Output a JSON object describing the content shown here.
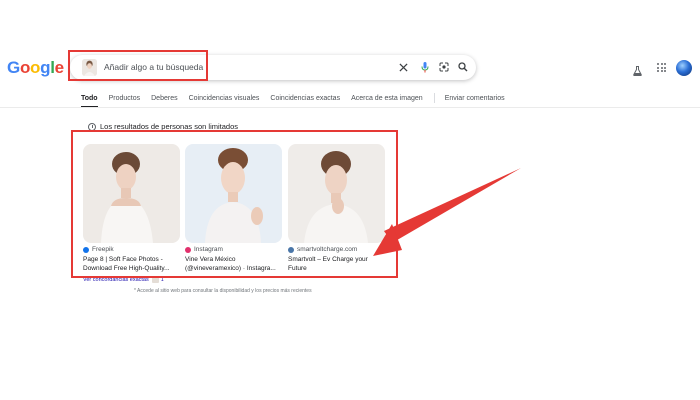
{
  "logo": {
    "letters": [
      "G",
      "o",
      "o",
      "g",
      "l",
      "e"
    ],
    "colors": [
      "#4285f4",
      "#ea4335",
      "#fbbc05",
      "#4285f4",
      "#34a853",
      "#ea4335"
    ]
  },
  "search": {
    "placeholder": "Añadir algo a tu búsqueda",
    "icons": [
      "clear-icon",
      "microphone-icon",
      "lens-icon",
      "search-icon"
    ]
  },
  "tabs": [
    {
      "label": "Todo",
      "active": true
    },
    {
      "label": "Productos"
    },
    {
      "label": "Deberes"
    },
    {
      "label": "Coincidencias visuales"
    },
    {
      "label": "Coincidencias exactas"
    },
    {
      "label": "Acerca de esta imagen"
    },
    {
      "label": "Enviar comentarios"
    }
  ],
  "notice": "Los resultados de personas son limitados",
  "results": [
    {
      "source": "Freepik",
      "title": "Page 8 | Soft Face Photos - Download Free High-Quality...",
      "match_label": "Ver concordancias exactas",
      "match_count": "1"
    },
    {
      "source": "Instagram",
      "title": "Vine Vera México (@vineveramexico) · Instagra..."
    },
    {
      "source": "smartvoltcharge.com",
      "title": "Smartvolt – Ev Charge your Future"
    }
  ],
  "footnote": "* Accede al sitio web para consultar la disponibilidad y los precios más recientes",
  "colors": {
    "annotation_red": "#e53935",
    "link_blue": "#1a0dab",
    "freepik_blue": "#1273eb",
    "instagram_pink": "#e1306c",
    "smartvolt_blue": "#4a76a8"
  }
}
